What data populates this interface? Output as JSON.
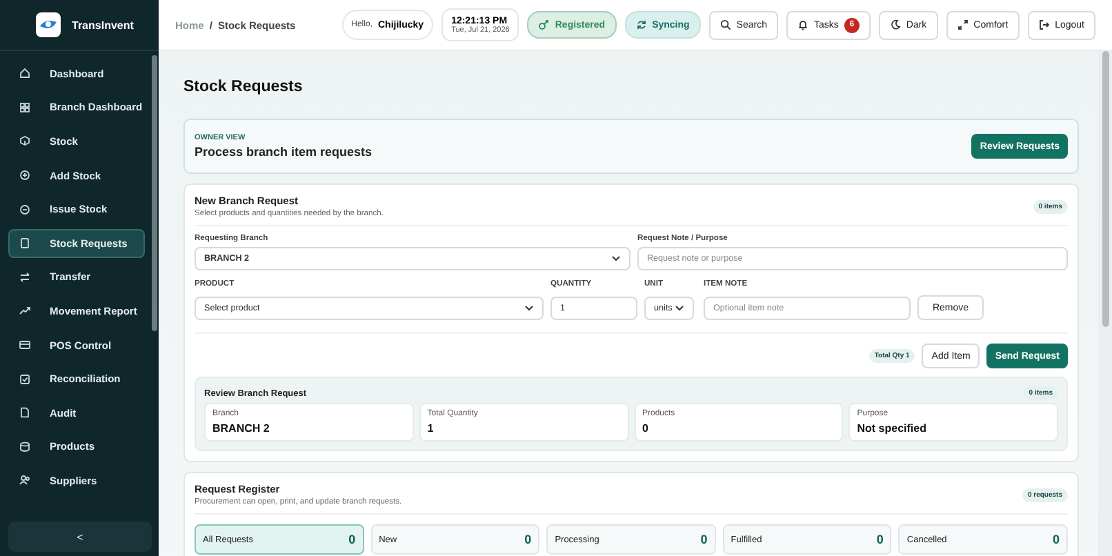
{
  "brand": {
    "name": "TransInvent"
  },
  "sidebar": {
    "items": [
      {
        "label": "Dashboard",
        "selected": false
      },
      {
        "label": "Branch Dashboard",
        "selected": false
      },
      {
        "label": "Stock",
        "selected": false
      },
      {
        "label": "Add Stock",
        "selected": false
      },
      {
        "label": "Issue Stock",
        "selected": false
      },
      {
        "label": "Stock Requests",
        "selected": true
      },
      {
        "label": "Transfer",
        "selected": false
      },
      {
        "label": "Movement Report",
        "selected": false
      },
      {
        "label": "POS Control",
        "selected": false
      },
      {
        "label": "Reconciliation",
        "selected": false
      },
      {
        "label": "Audit",
        "selected": false
      },
      {
        "label": "Products",
        "selected": false
      },
      {
        "label": "Suppliers",
        "selected": false
      }
    ],
    "collapse_button": "<"
  },
  "topbar": {
    "breadcrumb": [
      "Home",
      "Stock Requests"
    ],
    "breadcrumb_separator": "/",
    "greeting": "Hello,",
    "user": "Chijilucky",
    "time": "12:21:13 PM",
    "date": "Tue, Jul 21, 2026",
    "badges": [
      {
        "label": "Registered",
        "kind": "registered"
      },
      {
        "label": "Syncing",
        "kind": "syncing"
      }
    ],
    "buttons": [
      {
        "label": "Search"
      },
      {
        "label": "Tasks",
        "count": "6"
      },
      {
        "label": "Dark"
      },
      {
        "label": "Comfort"
      },
      {
        "label": "Logout"
      }
    ]
  },
  "page_title": "Stock Requests",
  "owner_card": {
    "eyebrow": "OWNER VIEW",
    "title": "Process branch item requests",
    "button": "Review Requests"
  },
  "new_request": {
    "title": "New Branch Request",
    "subtitle": "Select products and quantities needed by the branch.",
    "count": "0 items",
    "branch_label": "Requesting Branch",
    "branch_value": "BRANCH 2",
    "note_label": "Request Note / Purpose",
    "note_placeholder": "Request note or purpose",
    "item_headers": [
      "PRODUCT",
      "QUANTITY",
      "UNIT",
      "ITEM NOTE"
    ],
    "item": {
      "product": "Select product",
      "quantity": "1",
      "unit": "units",
      "note_placeholder": "Optional item note",
      "remove": "Remove"
    },
    "total": "Total Qty 1",
    "add_button": "Add Item",
    "send_button": "Send Request",
    "review": {
      "title": "Review Branch Request",
      "count": "0 items",
      "stats": [
        {
          "label": "Branch",
          "value": "BRANCH 2"
        },
        {
          "label": "Total Quantity",
          "value": "1"
        },
        {
          "label": "Products",
          "value": "0"
        },
        {
          "label": "Purpose",
          "value": "Not specified"
        }
      ]
    }
  },
  "register": {
    "title": "Request Register",
    "subtitle": "Procurement can open, print, and update branch requests.",
    "count": "0 requests",
    "filters": [
      {
        "label": "All Requests",
        "value": "0",
        "selected": true
      },
      {
        "label": "New",
        "value": "0",
        "selected": false
      },
      {
        "label": "Processing",
        "value": "0",
        "selected": false
      },
      {
        "label": "Fulfilled",
        "value": "0",
        "selected": false
      },
      {
        "label": "Cancelled",
        "value": "0",
        "selected": false
      }
    ]
  }
}
